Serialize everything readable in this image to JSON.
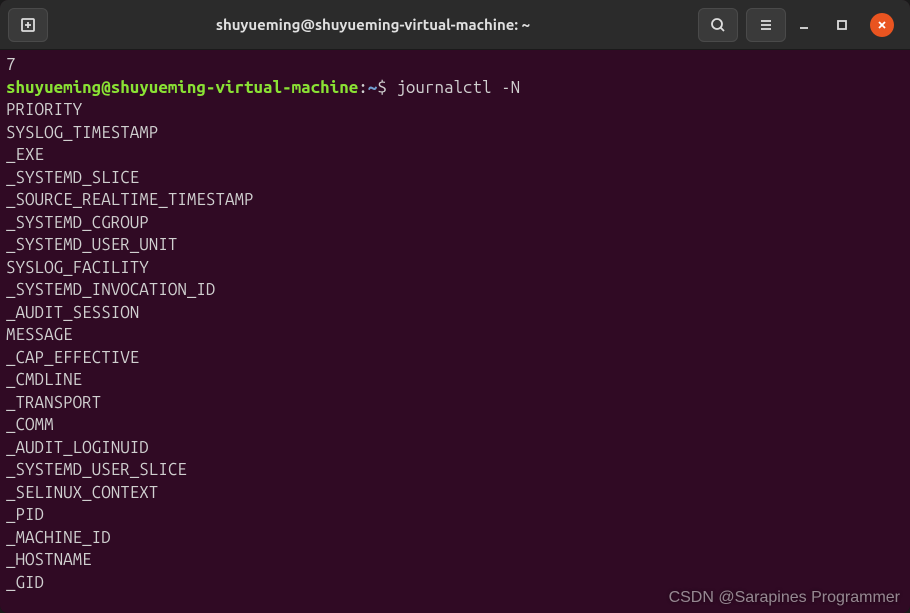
{
  "titlebar": {
    "title": "shuyueming@shuyueming-virtual-machine: ~"
  },
  "terminal": {
    "prev_output": "7",
    "prompt": {
      "user_host": "shuyueming@shuyueming-virtual-machine",
      "separator": ":",
      "path": "~",
      "symbol": "$"
    },
    "command": "journalctl -N",
    "output_lines": [
      "PRIORITY",
      "SYSLOG_TIMESTAMP",
      "_EXE",
      "_SYSTEMD_SLICE",
      "_SOURCE_REALTIME_TIMESTAMP",
      "_SYSTEMD_CGROUP",
      "_SYSTEMD_USER_UNIT",
      "SYSLOG_FACILITY",
      "_SYSTEMD_INVOCATION_ID",
      "_AUDIT_SESSION",
      "MESSAGE",
      "_CAP_EFFECTIVE",
      "_CMDLINE",
      "_TRANSPORT",
      "_COMM",
      "_AUDIT_LOGINUID",
      "_SYSTEMD_USER_SLICE",
      "_SELINUX_CONTEXT",
      "_PID",
      "_MACHINE_ID",
      "_HOSTNAME",
      "_GID"
    ]
  },
  "watermark": "CSDN @Sarapines Programmer"
}
